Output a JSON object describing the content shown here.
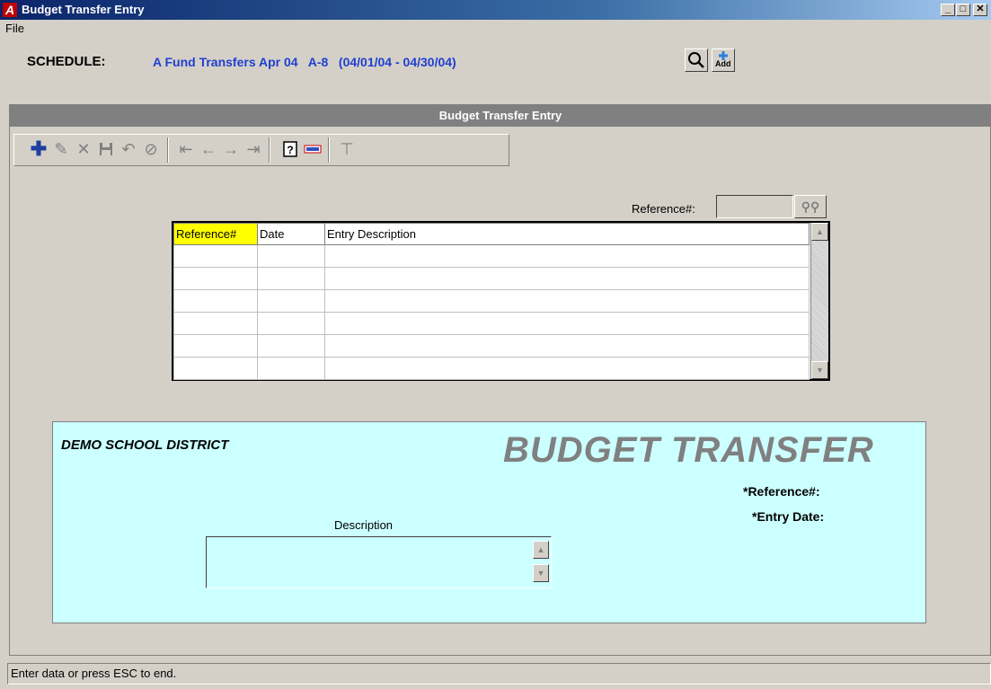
{
  "window": {
    "title": "Budget Transfer Entry",
    "logo_letter": "A",
    "controls": {
      "minimize": "_",
      "maximize": "□",
      "close": "✕"
    }
  },
  "menu": {
    "file_label": "File"
  },
  "schedule": {
    "label": "SCHEDULE:",
    "value": "A Fund Transfers Apr 04   A-8   (04/01/04 - 04/30/04)"
  },
  "top_buttons": {
    "search_icon": "magnifier-icon",
    "add_label": "Add"
  },
  "panel": {
    "title": "Budget Transfer Entry"
  },
  "toolbar_icons": [
    "add-icon",
    "edit-icon",
    "delete-icon",
    "save-icon",
    "undo-icon",
    "cancel-icon",
    "first-icon",
    "previous-icon",
    "next-icon",
    "last-icon",
    "help-icon",
    "calculator-icon",
    "filter-icon"
  ],
  "search": {
    "label": "Reference#:",
    "value": ""
  },
  "grid": {
    "columns": [
      "Reference#",
      "Date",
      "Entry Description"
    ],
    "rows": [
      [
        "",
        "",
        ""
      ],
      [
        "",
        "",
        ""
      ],
      [
        "",
        "",
        ""
      ],
      [
        "",
        "",
        ""
      ],
      [
        "",
        "",
        ""
      ],
      [
        "",
        "",
        ""
      ]
    ]
  },
  "form": {
    "district": "DEMO SCHOOL DISTRICT",
    "title": "BUDGET TRANSFER",
    "reference_label": "*Reference#:",
    "date_label": "*Entry Date:",
    "description_label": "Description",
    "description_value": ""
  },
  "status": {
    "text": "Enter data or press ESC to end."
  },
  "colors": {
    "title_bar": "#0a246a",
    "schedule_text": "#1f3fd0",
    "highlight_header": "#ffff00",
    "form_background": "#ccffff",
    "panel_header": "#808080"
  }
}
